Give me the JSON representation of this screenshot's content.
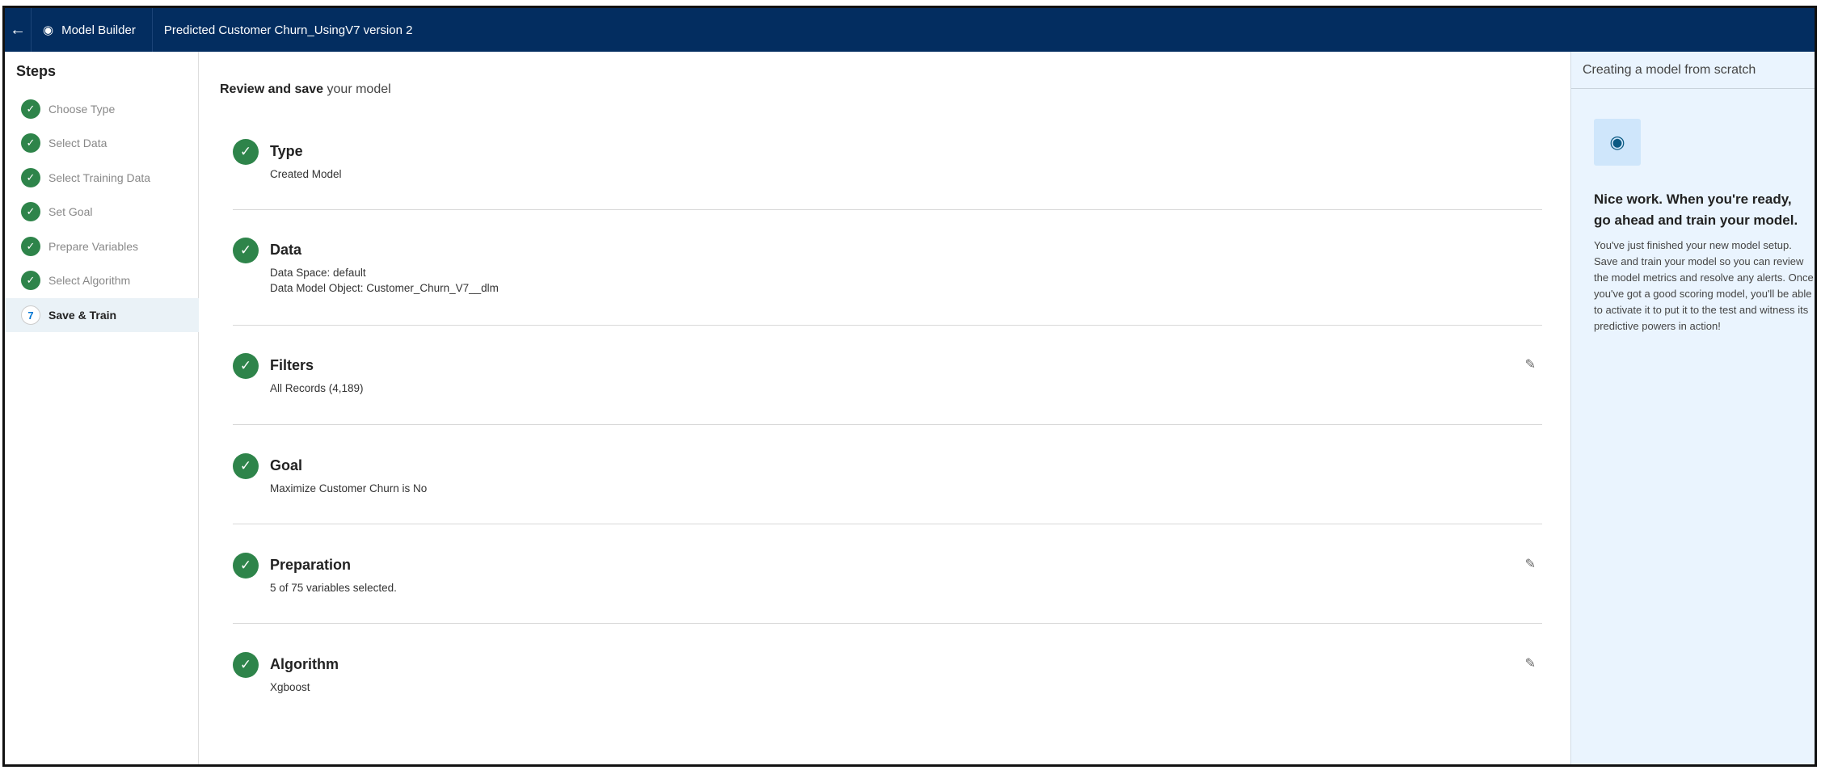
{
  "header": {
    "back_icon": "arrow-left-icon",
    "app_name": "Model Builder",
    "app_icon": "einstein-icon",
    "title": "Predicted Customer Churn_UsingV7 version 2"
  },
  "sidebar": {
    "heading": "Steps",
    "items": [
      {
        "label": "Choose Type",
        "status": "complete"
      },
      {
        "label": "Select Data",
        "status": "complete"
      },
      {
        "label": "Select Training Data",
        "status": "complete"
      },
      {
        "label": "Set Goal",
        "status": "complete"
      },
      {
        "label": "Prepare Variables",
        "status": "complete"
      },
      {
        "label": "Select Algorithm",
        "status": "complete"
      },
      {
        "label": "Save & Train",
        "status": "active",
        "number": "7"
      }
    ]
  },
  "main": {
    "heading_bold": "Review and save",
    "heading_rest": " your model",
    "sections": [
      {
        "title": "Type",
        "lines": [
          "Created Model"
        ],
        "editable": false
      },
      {
        "title": "Data",
        "lines": [
          "Data Space: default",
          "Data Model Object: Customer_Churn_V7__dlm"
        ],
        "editable": false
      },
      {
        "title": "Filters",
        "lines": [
          "All Records (4,189)"
        ],
        "editable": true
      },
      {
        "title": "Goal",
        "lines": [
          "Maximize Customer Churn is No"
        ],
        "editable": false
      },
      {
        "title": "Preparation",
        "lines": [
          "5 of 75 variables selected."
        ],
        "editable": true
      },
      {
        "title": "Algorithm",
        "lines": [
          "Xgboost"
        ],
        "editable": true
      }
    ]
  },
  "panel": {
    "header": "Creating a model from scratch",
    "title": "Nice work. When you're ready, go ahead and train your model.",
    "body": "You've just finished your new model setup. Save and train your model so you can review the model metrics and resolve any alerts. Once you've got a good scoring model, you'll be able to activate it to put it to the test and witness its predictive powers in action!"
  },
  "colors": {
    "header": "#032d60",
    "success": "#2e844a",
    "panel": "#eaf4fe"
  }
}
